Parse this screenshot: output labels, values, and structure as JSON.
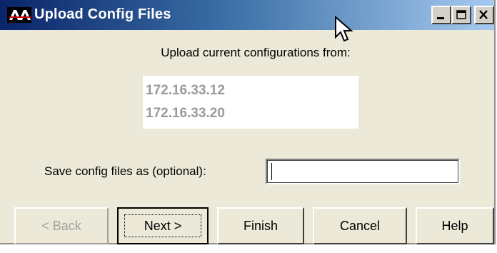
{
  "window": {
    "title": "Upload Config Files",
    "controls": {
      "minimize_icon": "minimize-icon",
      "maximize_icon": "maximize-icon",
      "close_icon": "close-icon"
    }
  },
  "main": {
    "prompt": "Upload current configurations from:",
    "hosts": [
      "172.16.33.12",
      "172.16.33.20"
    ],
    "save_label": "Save config files as (optional):",
    "save_value": ""
  },
  "buttons": {
    "back": "< Back",
    "next": "Next >",
    "finish": "Finish",
    "cancel": "Cancel",
    "help": "Help"
  },
  "colors": {
    "title_gradient_start": "#0a246a",
    "title_gradient_end": "#a6caf0",
    "dialog_bg": "#ece9d8",
    "host_text": "#9a9a9a"
  }
}
